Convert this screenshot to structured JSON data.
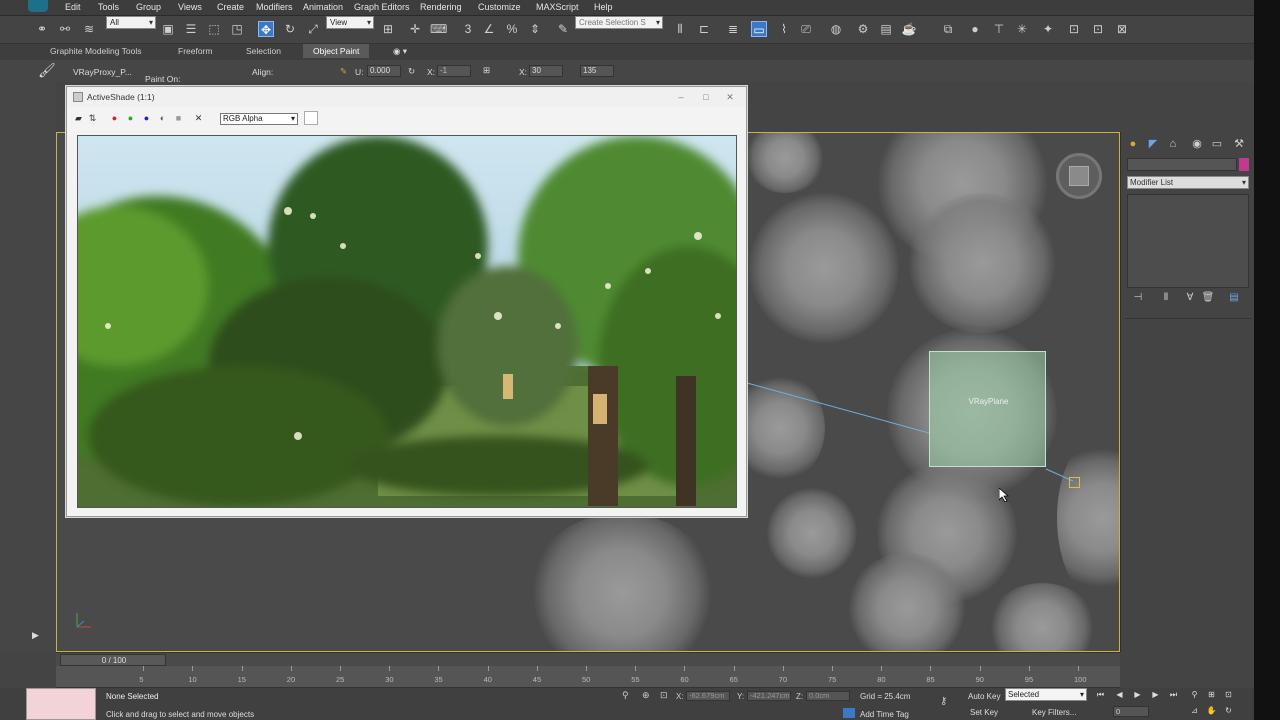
{
  "menu": {
    "items": [
      "Edit",
      "Tools",
      "Group",
      "Views",
      "Create",
      "Modifiers",
      "Animation",
      "Graph Editors",
      "Rendering",
      "Customize",
      "MAXScript",
      "Help"
    ]
  },
  "toolbar": {
    "filter_value": "All",
    "refcoord_value": "View",
    "selection_set_placeholder": "Create Selection S"
  },
  "ribbon": {
    "tabs": [
      "Graphite Modeling Tools",
      "Freeform",
      "Selection",
      "Object Paint"
    ],
    "active_tab": "Object Paint",
    "brush_object": "VRayProxy_P...",
    "paint_on": "Paint On:",
    "align": "Align:",
    "u_label": "U:",
    "u_value": "0.000",
    "x_label": "X:",
    "x_value": "-1",
    "scale_x_label": "X:",
    "scale_x_value": "30",
    "scale_extra": "135"
  },
  "activeshade": {
    "title": "ActiveShade (1:1)",
    "channel": "RGB Alpha",
    "swatch_color": "#ffffff"
  },
  "viewport": {
    "border_color": "#c8b441",
    "plane_label": "VRayPlane"
  },
  "command_panel": {
    "modifier_list": "Modifier List",
    "object_color": "#c23a8d"
  },
  "timeline": {
    "slider_label": "0 / 100",
    "ticks": [
      "5",
      "10",
      "15",
      "20",
      "25",
      "30",
      "35",
      "40",
      "45",
      "50",
      "55",
      "60",
      "65",
      "70",
      "75",
      "80",
      "85",
      "90",
      "95",
      "100"
    ]
  },
  "status": {
    "selection": "None Selected",
    "prompt": "Click and drag to select and move objects",
    "x_label": "X:",
    "x_value": "-62.679cm",
    "y_label": "Y:",
    "y_value": "-421.247cm",
    "z_label": "Z:",
    "z_value": "0.0cm",
    "grid": "Grid = 25.4cm",
    "add_time_tag": "Add Time Tag",
    "auto_key": "Auto Key",
    "auto_key_mode": "Selected",
    "set_key": "Set Key",
    "key_filters": "Key Filters...",
    "current_frame": "0"
  }
}
